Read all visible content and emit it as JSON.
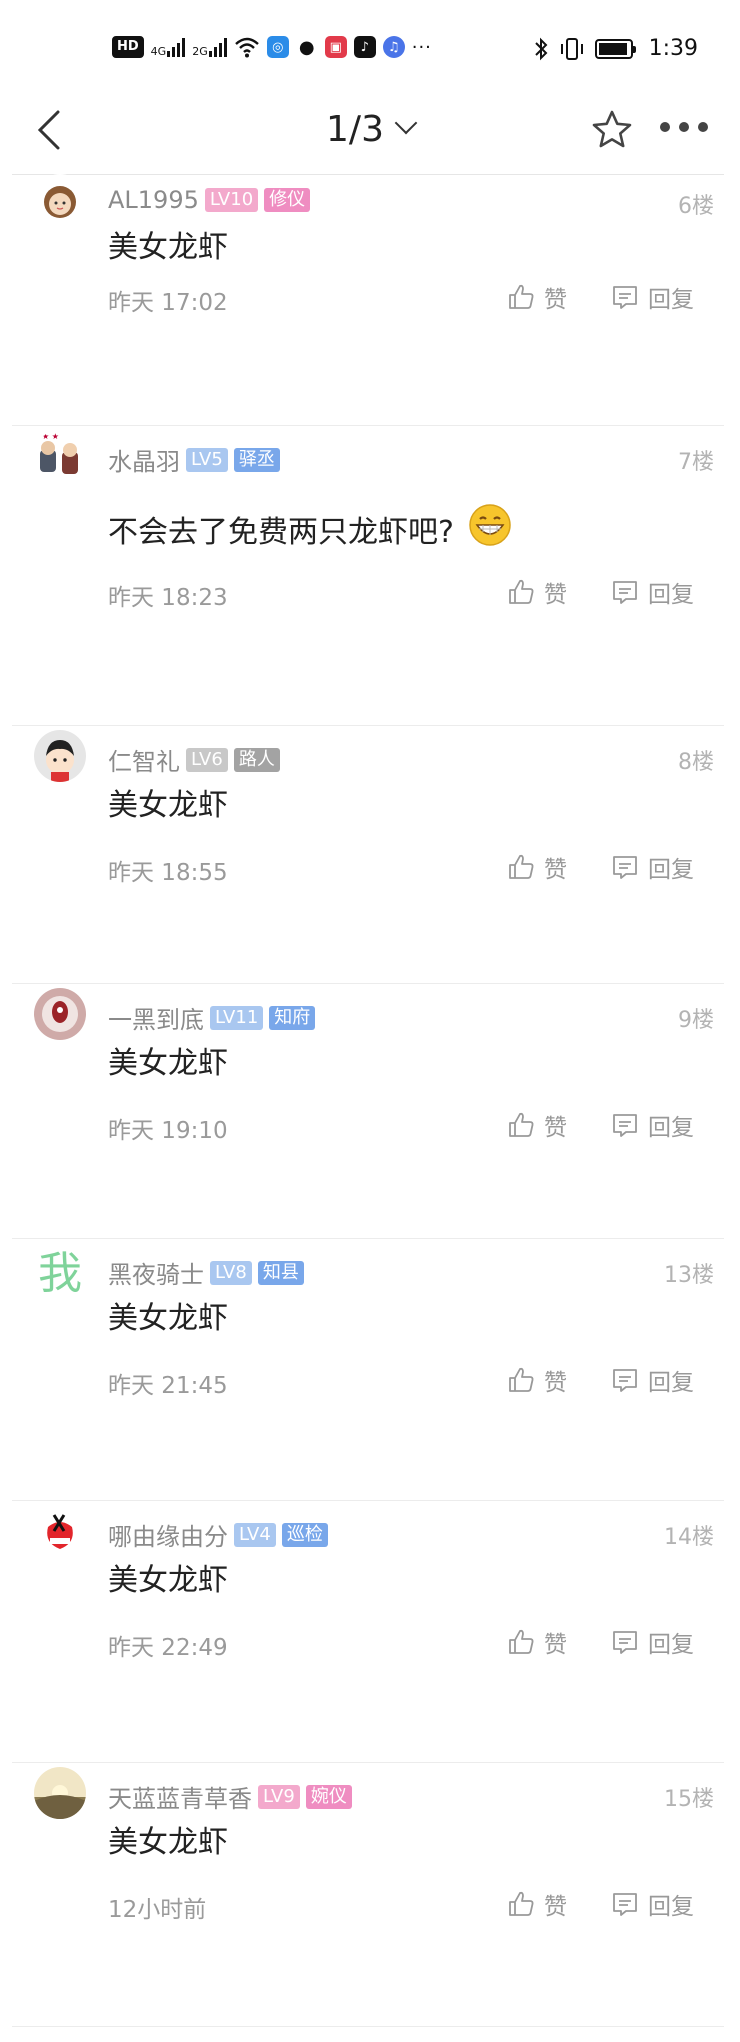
{
  "status_bar": {
    "hd": "HD",
    "net1": "4G",
    "net2": "2G",
    "time": "1:39",
    "icons": [
      "hd-icon",
      "signal-4g-icon",
      "signal-2g-icon",
      "wifi-icon",
      "app-icon",
      "wechat-icon",
      "gift-app-icon",
      "tiktok-icon",
      "music-app-icon",
      "more-dots-icon",
      "bluetooth-icon",
      "vibrate-icon",
      "battery-icon"
    ]
  },
  "nav": {
    "page": "1/3",
    "icons": [
      "back-arrow-icon",
      "chevron-down-icon",
      "star-icon",
      "more-icon"
    ]
  },
  "actions": {
    "like": "赞",
    "reply": "回复"
  },
  "posts": [
    {
      "user": "AL1995",
      "level": "LV10",
      "title": "修仪",
      "floor": "6楼",
      "content": "美女龙虾",
      "time": "昨天 17:02",
      "level_color": "#f3a9cc",
      "title_color": "#ef8dc1"
    },
    {
      "user": "水晶羽",
      "level": "LV5",
      "title": "驿丞",
      "floor": "7楼",
      "content": "不会去了免费两只龙虾吧?",
      "emoji": "grinning-face-icon",
      "time": "昨天 18:23",
      "level_color": "#a9c7f0",
      "title_color": "#79a7ea"
    },
    {
      "user": "仁智礼",
      "level": "LV6",
      "title": "路人",
      "floor": "8楼",
      "content": "美女龙虾",
      "time": "昨天 18:55",
      "level_color": "#c8c8c8",
      "title_color": "#a3a3a3"
    },
    {
      "user": "一黑到底",
      "level": "LV11",
      "title": "知府",
      "floor": "9楼",
      "content": "美女龙虾",
      "time": "昨天 19:10",
      "level_color": "#a9c7f0",
      "title_color": "#79a7ea"
    },
    {
      "user": "黑夜骑士",
      "level": "LV8",
      "title": "知县",
      "floor": "13楼",
      "content": "美女龙虾",
      "time": "昨天 21:45",
      "level_color": "#a9c7f0",
      "title_color": "#79a7ea"
    },
    {
      "user": "哪由缘由分",
      "level": "LV4",
      "title": "巡检",
      "floor": "14楼",
      "content": "美女龙虾",
      "time": "昨天 22:49",
      "level_color": "#a9c7f0",
      "title_color": "#79a7ea"
    },
    {
      "user": "天蓝蓝青草香",
      "level": "LV9",
      "title": "婉仪",
      "floor": "15楼",
      "content": "美女龙虾",
      "time": "12小时前",
      "level_color": "#f3a9cc",
      "title_color": "#ef8dc1"
    }
  ],
  "avatar_text": "我"
}
